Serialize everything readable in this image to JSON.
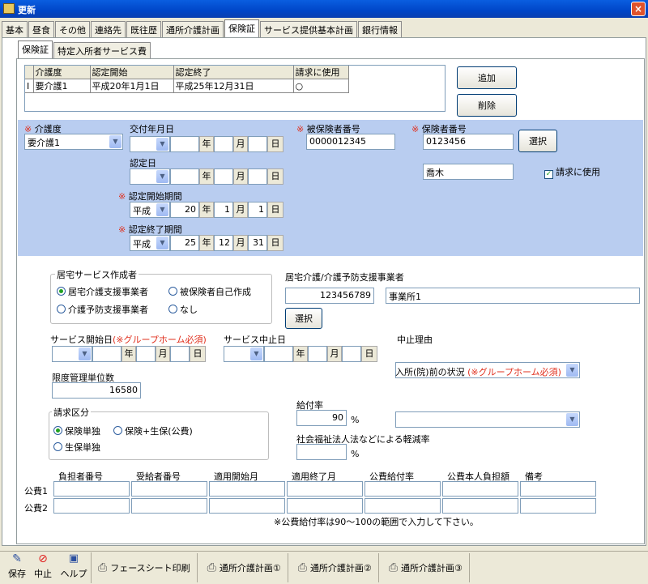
{
  "window": {
    "title": "更新",
    "close": "×"
  },
  "main_tabs": [
    "基本",
    "昼食",
    "その他",
    "連絡先",
    "既往歴",
    "通所介護計画",
    "保険証",
    "サービス提供基本計画",
    "銀行情報"
  ],
  "active_main_tab": 6,
  "sub_tabs": [
    "保険証",
    "特定入所者サービス費"
  ],
  "active_sub_tab": 0,
  "grid": {
    "headers": [
      "介護度",
      "認定開始",
      "認定終了",
      "請求に使用"
    ],
    "rows": [
      {
        "marker": "I",
        "care": "要介護1",
        "start": "平成20年1月1日",
        "end": "平成25年12月31日",
        "use": "○"
      }
    ]
  },
  "buttons": {
    "add": "追加",
    "delete": "削除",
    "select1": "選択",
    "select2": "選択"
  },
  "form": {
    "req_mark": "※",
    "care_level_label": "介護度",
    "care_level_value": "要介護1",
    "issue_date_label": "交付年月日",
    "cert_date_label": "認定日",
    "cert_start_label": "認定開始期間",
    "cert_end_label": "認定終了期間",
    "era_label": "平成",
    "start_year": "20",
    "start_month": "1",
    "start_day": "1",
    "end_year": "25",
    "end_month": "12",
    "end_day": "31",
    "unit_year": "年",
    "unit_month": "月",
    "unit_day": "日",
    "insured_no_label": "被保険者番号",
    "insured_no_value": "0000012345",
    "insurer_no_label": "保険者番号",
    "insurer_no_value": "0123456",
    "insurer_name_value": "喬木",
    "billing_use_label": "請求に使用",
    "billing_use_checked": true
  },
  "lower": {
    "creator_group": "居宅サービス作成者",
    "creator_options": [
      "居宅介護支援事業者",
      "被保険者自己作成",
      "介護予防支援事業者",
      "なし"
    ],
    "creator_selected": 0,
    "office_label": "居宅介護/介護予防支援事業者",
    "office_code": "123456789",
    "office_name": "事業所1",
    "service_start_label": "サービス開始日",
    "service_start_note": "(※グループホーム必須)",
    "service_stop_label": "サービス中止日",
    "stop_reason_label": "中止理由",
    "prior_status_label": "入所(院)前の状況",
    "prior_status_note": "(※グループホーム必須)",
    "limit_label": "限度管理単位数",
    "limit_value": "16580",
    "billing_group": "請求区分",
    "billing_options": [
      "保険単独",
      "保険+生保(公費)",
      "生保単独"
    ],
    "billing_selected": 0,
    "benefit_rate_label": "給付率",
    "benefit_rate_value": "90",
    "percent": "%",
    "reduction_label": "社会福祉法人法などによる軽減率",
    "reduction_value": ""
  },
  "public_funds": {
    "headers": [
      "負担者番号",
      "受給者番号",
      "適用開始月",
      "適用終了月",
      "公費給付率",
      "公費本人負担額",
      "備考"
    ],
    "rows": [
      "公費1",
      "公費2"
    ],
    "note": "※公費給付率は90～100の範囲で入力して下さい。"
  },
  "toolbar": {
    "save": "保存",
    "stop": "中止",
    "help": "ヘルプ",
    "face": "フェースシート印刷",
    "plan1": "通所介護計画①",
    "plan2": "通所介護計画②",
    "plan3": "通所介護計画③"
  },
  "colors": {
    "title_bar": "#0046c8",
    "blue_panel": "#b9cdf0",
    "required": "#e0301e",
    "close": "#e0532c"
  }
}
